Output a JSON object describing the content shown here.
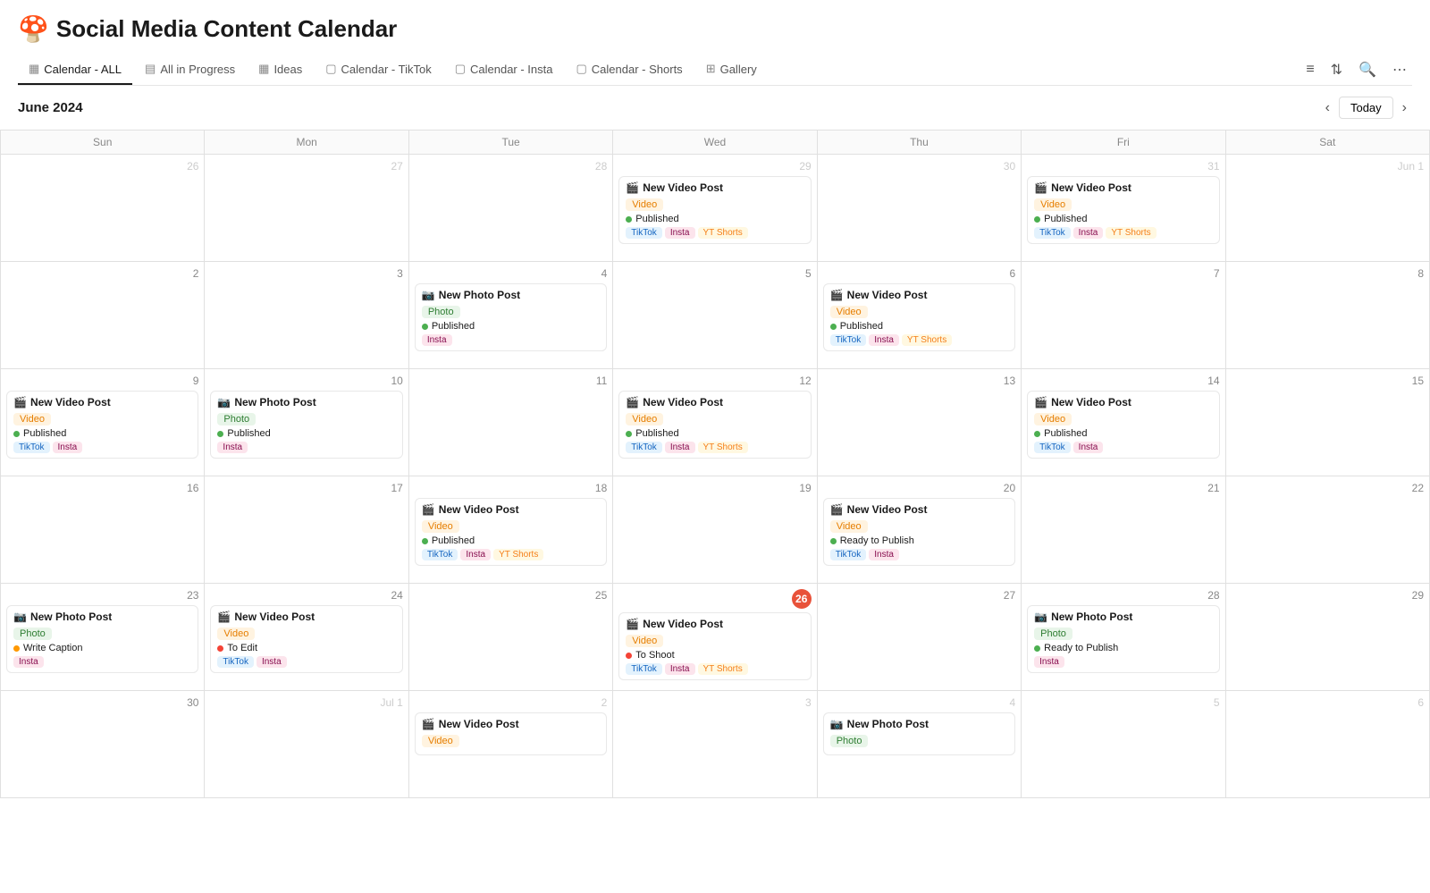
{
  "header": {
    "emoji": "🍄",
    "title": "Social Media Content Calendar"
  },
  "nav": {
    "items": [
      {
        "id": "calendar-all",
        "label": "Calendar - ALL",
        "icon": "▦",
        "active": true
      },
      {
        "id": "all-in-progress",
        "label": "All in Progress",
        "icon": "▤"
      },
      {
        "id": "ideas",
        "label": "Ideas",
        "icon": "▦"
      },
      {
        "id": "calendar-tiktok",
        "label": "Calendar - TikTok",
        "icon": "▢"
      },
      {
        "id": "calendar-insta",
        "label": "Calendar - Insta",
        "icon": "▢"
      },
      {
        "id": "calendar-shorts",
        "label": "Calendar - Shorts",
        "icon": "▢"
      },
      {
        "id": "gallery",
        "label": "Gallery",
        "icon": "⊞"
      }
    ]
  },
  "calendar": {
    "month": "June 2024",
    "today_label": "Today",
    "day_headers": [
      "Sun",
      "Mon",
      "Tue",
      "Wed",
      "Thu",
      "Fri",
      "Sat"
    ],
    "weeks": [
      [
        {
          "num": "26",
          "other": true,
          "events": []
        },
        {
          "num": "27",
          "other": true,
          "events": []
        },
        {
          "num": "28",
          "other": true,
          "events": []
        },
        {
          "num": "29",
          "other": true,
          "events": [
            {
              "title": "New Video Post",
              "emoji": "🎬",
              "type": "video",
              "status": "Published",
              "status_type": "published",
              "platforms": [
                "TikTok",
                "Insta",
                "YT Shorts"
              ]
            }
          ]
        },
        {
          "num": "30",
          "other": true,
          "events": []
        },
        {
          "num": "31",
          "other": true,
          "events": [
            {
              "title": "New Video Post",
              "emoji": "🎬",
              "type": "video",
              "status": "Published",
              "status_type": "published",
              "platforms": [
                "TikTok",
                "Insta",
                "YT Shorts"
              ]
            }
          ]
        },
        {
          "num": "Jun 1",
          "jun1": true,
          "events": []
        }
      ],
      [
        {
          "num": "2",
          "events": []
        },
        {
          "num": "3",
          "events": []
        },
        {
          "num": "4",
          "events": [
            {
              "title": "New Photo Post",
              "emoji": "📷",
              "type": "photo",
              "status": "Published",
              "status_type": "published",
              "platforms": [
                "Insta"
              ]
            }
          ]
        },
        {
          "num": "5",
          "events": []
        },
        {
          "num": "6",
          "events": [
            {
              "title": "New Video Post",
              "emoji": "🎬",
              "type": "video",
              "status": "Published",
              "status_type": "published",
              "platforms": [
                "TikTok",
                "Insta",
                "YT Shorts"
              ]
            }
          ]
        },
        {
          "num": "7",
          "events": []
        },
        {
          "num": "8",
          "events": []
        }
      ],
      [
        {
          "num": "9",
          "events": [
            {
              "title": "New Video Post",
              "emoji": "🎬",
              "type": "video",
              "status": "Published",
              "status_type": "published",
              "platforms": [
                "TikTok",
                "Insta"
              ]
            }
          ]
        },
        {
          "num": "10",
          "events": [
            {
              "title": "New Photo Post",
              "emoji": "📷",
              "type": "photo",
              "status": "Published",
              "status_type": "published",
              "platforms": [
                "Insta"
              ]
            }
          ]
        },
        {
          "num": "11",
          "events": []
        },
        {
          "num": "12",
          "events": [
            {
              "title": "New Video Post",
              "emoji": "🎬",
              "type": "video",
              "status": "Published",
              "status_type": "published",
              "platforms": [
                "TikTok",
                "Insta",
                "YT Shorts"
              ]
            }
          ]
        },
        {
          "num": "13",
          "events": []
        },
        {
          "num": "14",
          "events": [
            {
              "title": "New Video Post",
              "emoji": "🎬",
              "type": "video",
              "status": "Published",
              "status_type": "published",
              "platforms": [
                "TikTok",
                "Insta"
              ]
            }
          ]
        },
        {
          "num": "15",
          "events": []
        }
      ],
      [
        {
          "num": "16",
          "events": []
        },
        {
          "num": "17",
          "events": []
        },
        {
          "num": "18",
          "events": [
            {
              "title": "New Video Post",
              "emoji": "🎬",
              "type": "video",
              "status": "Published",
              "status_type": "published",
              "platforms": [
                "TikTok",
                "Insta",
                "YT Shorts"
              ]
            }
          ]
        },
        {
          "num": "19",
          "events": []
        },
        {
          "num": "20",
          "events": [
            {
              "title": "New Video Post",
              "emoji": "🎬",
              "type": "video",
              "status": "Ready to Publish",
              "status_type": "ready",
              "platforms": [
                "TikTok",
                "Insta"
              ]
            }
          ]
        },
        {
          "num": "21",
          "events": []
        },
        {
          "num": "22",
          "events": []
        }
      ],
      [
        {
          "num": "23",
          "events": [
            {
              "title": "New Photo Post",
              "emoji": "📷",
              "type": "photo",
              "status": "Write Caption",
              "status_type": "write-caption",
              "platforms": [
                "Insta"
              ]
            }
          ]
        },
        {
          "num": "24",
          "events": [
            {
              "title": "New Video Post",
              "emoji": "🎬",
              "type": "video",
              "status": "To Edit",
              "status_type": "to-edit",
              "platforms": [
                "TikTok",
                "Insta"
              ]
            }
          ]
        },
        {
          "num": "25",
          "events": []
        },
        {
          "num": "26",
          "today": true,
          "events": [
            {
              "title": "New Video Post",
              "emoji": "🎬",
              "type": "video",
              "status": "To Shoot",
              "status_type": "to-shoot",
              "platforms": [
                "TikTok",
                "Insta",
                "YT Shorts"
              ]
            }
          ]
        },
        {
          "num": "27",
          "events": []
        },
        {
          "num": "28",
          "events": [
            {
              "title": "New Photo Post",
              "emoji": "📷",
              "type": "photo",
              "status": "Ready to Publish",
              "status_type": "ready",
              "platforms": [
                "Insta"
              ]
            }
          ]
        },
        {
          "num": "29",
          "events": []
        }
      ],
      [
        {
          "num": "30",
          "events": []
        },
        {
          "num": "Jul 1",
          "other": true,
          "events": []
        },
        {
          "num": "2",
          "other": true,
          "events": [
            {
              "title": "New Video Post",
              "emoji": "🎬",
              "type": "video",
              "status": "",
              "status_type": "",
              "platforms": []
            }
          ]
        },
        {
          "num": "3",
          "other": true,
          "events": []
        },
        {
          "num": "4",
          "other": true,
          "events": [
            {
              "title": "New Photo Post",
              "emoji": "📷",
              "type": "photo",
              "status": "",
              "status_type": "",
              "platforms": []
            }
          ]
        },
        {
          "num": "5",
          "other": true,
          "events": []
        },
        {
          "num": "6",
          "other": true,
          "events": []
        }
      ]
    ]
  },
  "bottom_bar": {
    "new_photo_post": "New Photo Post",
    "new_video_post": "New Video Post"
  }
}
